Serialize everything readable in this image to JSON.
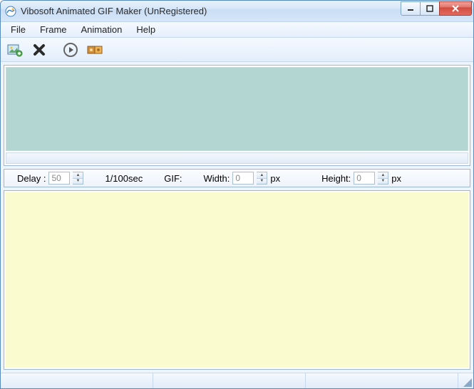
{
  "window": {
    "title": "Vibosoft Animated GIF Maker (UnRegistered)"
  },
  "menu": {
    "items": [
      "File",
      "Frame",
      "Animation",
      "Help"
    ]
  },
  "toolbar": {
    "icons": [
      "add-frame-icon",
      "delete-frame-icon",
      "play-icon",
      "export-icon"
    ]
  },
  "mid": {
    "delay_label": "Delay :",
    "delay_value": "50",
    "delay_unit": "1/100sec",
    "gif_label": "GIF:",
    "width_label": "Width:",
    "width_value": "0",
    "height_label": "Height:",
    "height_value": "0",
    "px": "px"
  },
  "colors": {
    "preview_bg": "#b3d6d3",
    "canvas_bg": "#fbfbd0"
  }
}
